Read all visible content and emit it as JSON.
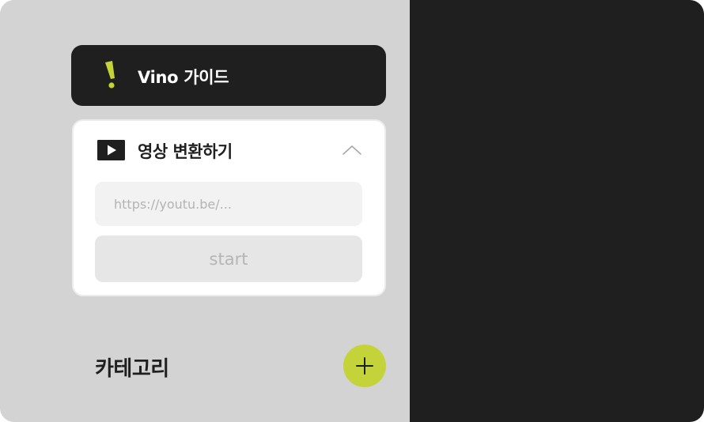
{
  "guide": {
    "label": "Vino 가이드",
    "icon": "vino-logo-icon"
  },
  "convert": {
    "title": "영상 변환하기",
    "icon": "play-video-icon",
    "collapse_icon": "chevron-up-icon",
    "url_placeholder": "https://youtu.be/...",
    "url_value": "",
    "start_label": "start"
  },
  "category": {
    "title": "카테고리",
    "add_icon": "plus-icon"
  },
  "colors": {
    "accent": "#c5d33b",
    "dark": "#1f1f1f",
    "sidebar_bg": "#d3d3d3",
    "card_bg": "#ffffff"
  }
}
